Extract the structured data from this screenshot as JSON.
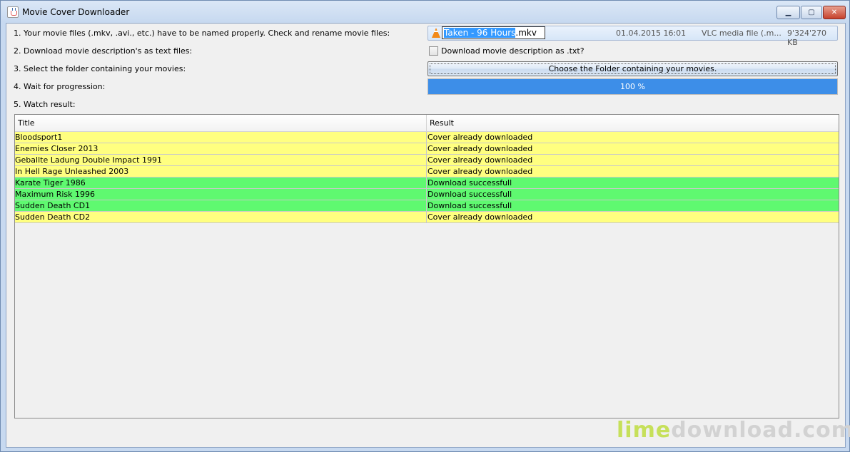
{
  "window": {
    "title": "Movie Cover Downloader",
    "controls": {
      "minimize": "▁",
      "maximize": "▢",
      "close": "✕"
    }
  },
  "steps": {
    "s1": "1. Your movie files (.mkv, .avi., etc.) have to be named properly. Check and rename movie files:",
    "s2": "2. Download movie description's as text files:",
    "s3": "3. Select the folder containing your movies:",
    "s4": "4. Wait for progression:",
    "s5": "5. Watch result:"
  },
  "file": {
    "icon": "vlc-cone-icon",
    "name_selected": "Taken - 96 Hours",
    "name_ext": ".mkv",
    "date": "01.04.2015 16:01",
    "type": "VLC media file (.m...",
    "size": "9'324'270 KB"
  },
  "description_checkbox": {
    "label": "Download movie description as .txt?",
    "checked": false
  },
  "choose_button": "Choose the Folder containing your movies.",
  "progress": {
    "value": 100,
    "label": "100 %"
  },
  "table": {
    "headers": {
      "title": "Title",
      "result": "Result"
    },
    "rows": [
      {
        "title": "Bloodsport1",
        "result": "Cover already downloaded",
        "status": "yellow"
      },
      {
        "title": "Enemies Closer 2013",
        "result": "Cover already downloaded",
        "status": "yellow"
      },
      {
        "title": "Geballte Ladung Double Impact 1991",
        "result": "Cover already downloaded",
        "status": "yellow"
      },
      {
        "title": "In Hell Rage Unleashed 2003",
        "result": "Cover already downloaded",
        "status": "yellow"
      },
      {
        "title": "Karate Tiger 1986",
        "result": "Download successfull",
        "status": "green"
      },
      {
        "title": "Maximum Risk 1996",
        "result": "Download successfull",
        "status": "green"
      },
      {
        "title": "Sudden Death CD1",
        "result": "Download successfull",
        "status": "green"
      },
      {
        "title": "Sudden Death CD2",
        "result": "Cover already downloaded",
        "status": "yellow"
      }
    ]
  },
  "colors": {
    "yellow_row": "#ffff80",
    "green_row": "#5ff970",
    "progress": "#3d8ee8"
  },
  "watermark": {
    "part1": "lime",
    "part2": "download.com"
  }
}
